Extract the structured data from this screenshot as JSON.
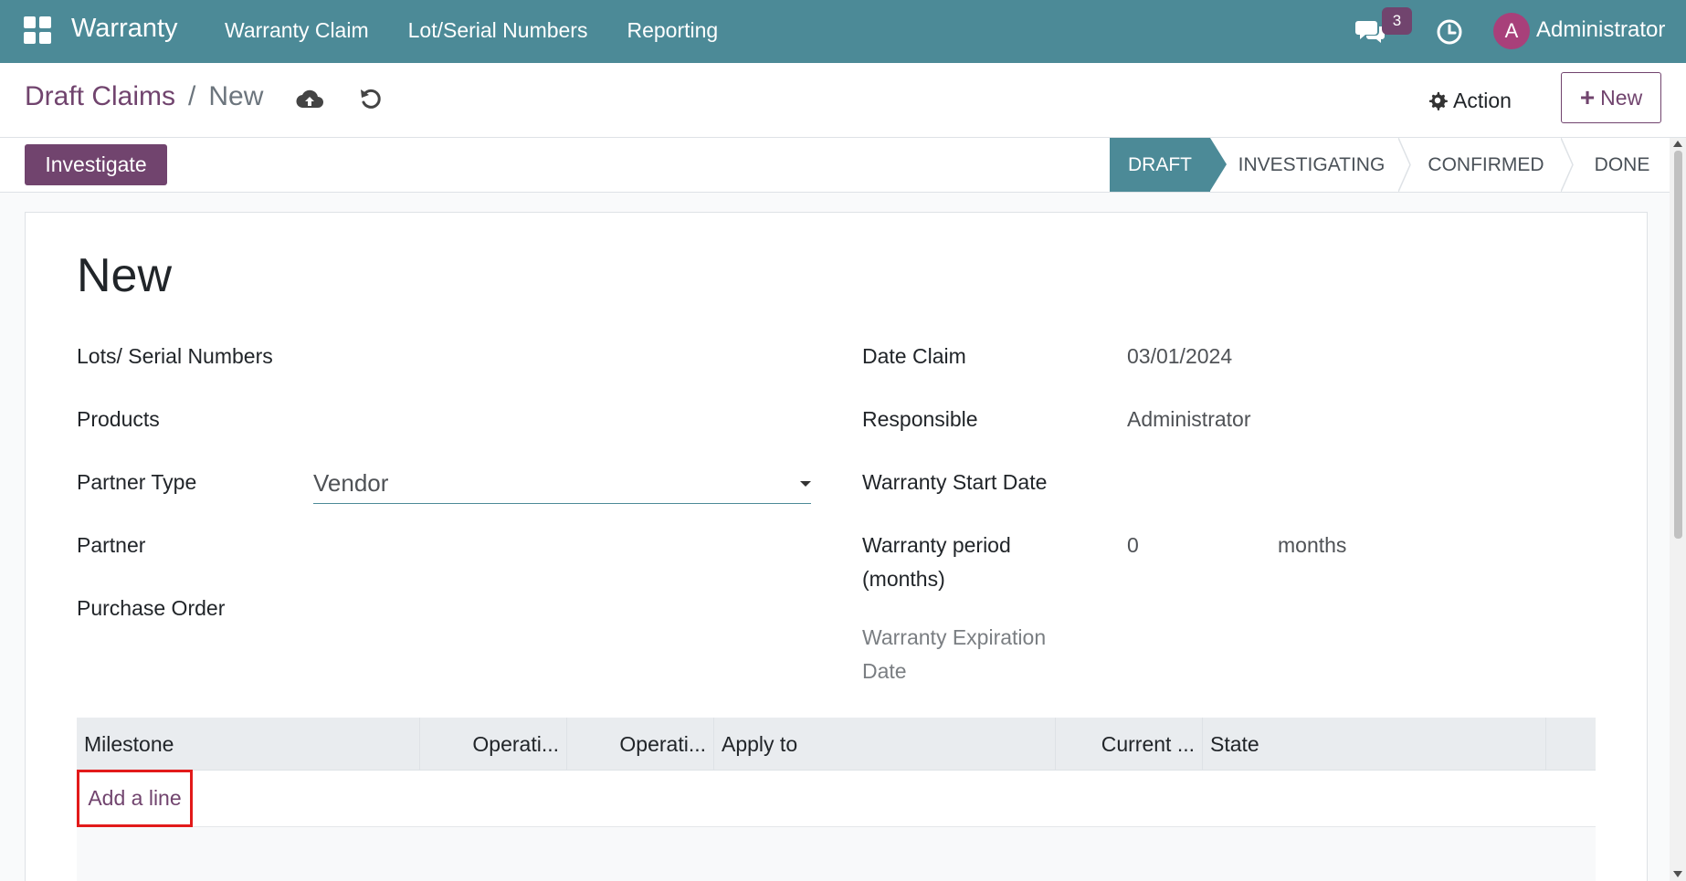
{
  "navbar": {
    "brand": "Warranty",
    "menu": [
      "Warranty Claim",
      "Lot/Serial Numbers",
      "Reporting"
    ],
    "message_count": "3",
    "user_initial": "A",
    "user_name": "Administrator",
    "icons": [
      "apps-grid-icon",
      "chat-icon",
      "clock-icon"
    ]
  },
  "control_panel": {
    "breadcrumb_parent": "Draft Claims",
    "breadcrumb_separator": "/",
    "breadcrumb_current": "New",
    "action_label": "Action",
    "new_button_label": "New",
    "icons": [
      "cloud-upload-icon",
      "undo-icon",
      "gear-icon",
      "plus-icon"
    ]
  },
  "statusbar": {
    "investigate_label": "Investigate",
    "stages": [
      "DRAFT",
      "INVESTIGATING",
      "CONFIRMED",
      "DONE"
    ],
    "active_stage": "DRAFT"
  },
  "form": {
    "title": "New",
    "left": {
      "lots_label": "Lots/ Serial Numbers",
      "products_label": "Products",
      "partner_type_label": "Partner Type",
      "partner_type_value": "Vendor",
      "partner_label": "Partner",
      "purchase_order_label": "Purchase Order"
    },
    "right": {
      "date_claim_label": "Date Claim",
      "date_claim_value": "03/01/2024",
      "responsible_label": "Responsible",
      "responsible_value": "Administrator",
      "warranty_start_label": "Warranty Start Date",
      "warranty_period_label_1": "Warranty period",
      "warranty_period_label_2": "(months)",
      "warranty_period_value": "0",
      "warranty_period_unit": "months",
      "expiration_label_1": "Warranty Expiration",
      "expiration_label_2": "Date"
    }
  },
  "milestone_table": {
    "columns": [
      "Milestone",
      "Operati...",
      "Operati...",
      "Apply to",
      "Current ...",
      "State"
    ],
    "add_line_label": "Add a line"
  },
  "colors": {
    "navbar": "#4c8a97",
    "primary": "#71446e",
    "highlight_border": "#e21a1a"
  }
}
